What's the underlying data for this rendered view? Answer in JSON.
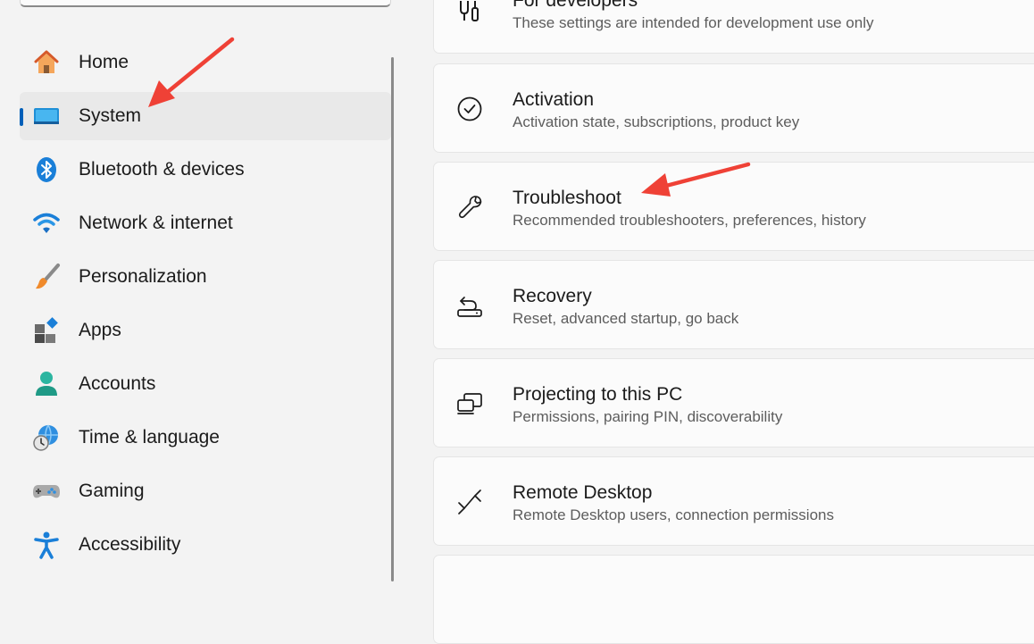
{
  "sidebar": {
    "items": [
      {
        "label": "Home",
        "icon": "home-icon"
      },
      {
        "label": "System",
        "icon": "monitor-icon",
        "selected": true
      },
      {
        "label": "Bluetooth & devices",
        "icon": "bluetooth-icon"
      },
      {
        "label": "Network & internet",
        "icon": "wifi-icon"
      },
      {
        "label": "Personalization",
        "icon": "paintbrush-icon"
      },
      {
        "label": "Apps",
        "icon": "apps-icon"
      },
      {
        "label": "Accounts",
        "icon": "person-icon"
      },
      {
        "label": "Time & language",
        "icon": "globe-clock-icon"
      },
      {
        "label": "Gaming",
        "icon": "gamepad-icon"
      },
      {
        "label": "Accessibility",
        "icon": "accessibility-icon"
      }
    ]
  },
  "main": {
    "cards": [
      {
        "title": "For developers",
        "description": "These settings are intended for development use only",
        "icon": "developer-tools-icon"
      },
      {
        "title": "Activation",
        "description": "Activation state, subscriptions, product key",
        "icon": "check-circle-icon"
      },
      {
        "title": "Troubleshoot",
        "description": "Recommended troubleshooters, preferences, history",
        "icon": "wrench-icon"
      },
      {
        "title": "Recovery",
        "description": "Reset, advanced startup, go back",
        "icon": "recovery-icon"
      },
      {
        "title": "Projecting to this PC",
        "description": "Permissions, pairing PIN, discoverability",
        "icon": "projecting-icon"
      },
      {
        "title": "Remote Desktop",
        "description": "Remote Desktop users, connection permissions",
        "icon": "remote-desktop-icon"
      }
    ]
  },
  "colors": {
    "accent": "#005fb8",
    "annotation_arrow": "#ef4136",
    "background": "#f3f3f3",
    "card_background": "#fbfbfb"
  }
}
